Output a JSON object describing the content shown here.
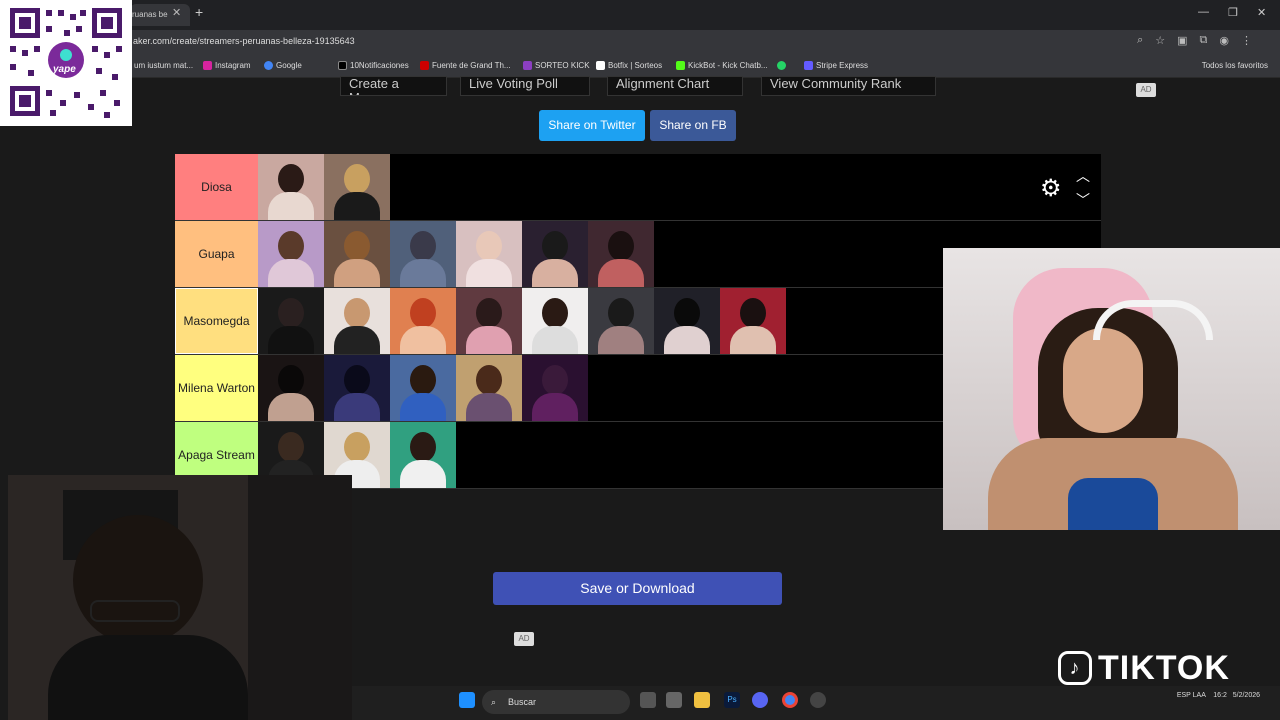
{
  "browser": {
    "tab_title": "ruanas be",
    "url": "aker.com/create/streamers-peruanas-belleza-19135643",
    "bookmarks": [
      "um iustum mat...",
      "Instagram",
      "Google",
      "10Notificaciones",
      "Fuente de Grand Th...",
      "SORTEO KICK",
      "Botfix | Sorteos",
      "KickBot - Kick Chatb...",
      "Stripe Express"
    ],
    "bookmarks_right": "Todos los favoritos",
    "new_tab": "+",
    "close": "✕"
  },
  "page": {
    "top_buttons": [
      "Create a Meme",
      "Live Voting Poll",
      "Alignment Chart",
      "View Community Rank"
    ],
    "ad_label": "AD",
    "share_twitter": "Share on Twitter",
    "share_fb": "Share on FB",
    "save_download": "Save or Download",
    "tiers": [
      {
        "label": "Diosa",
        "color": "#ff7f7f",
        "count": 2
      },
      {
        "label": "Guapa",
        "color": "#ffbf7f",
        "count": 6
      },
      {
        "label": "Masomegda",
        "color": "#ffdf7f",
        "count": 8
      },
      {
        "label": "Milena Warton",
        "color": "#ffff7f",
        "count": 5
      },
      {
        "label": "Apaga Stream",
        "color": "#bfff7f",
        "count": 3
      }
    ]
  },
  "taskbar": {
    "search": "Buscar",
    "tray_lang": "ESP LAA",
    "tray_time": "16:2",
    "tray_date": "5/2/2026"
  },
  "overlay": {
    "brand": "TIKTOK",
    "qr_label": "yape"
  }
}
